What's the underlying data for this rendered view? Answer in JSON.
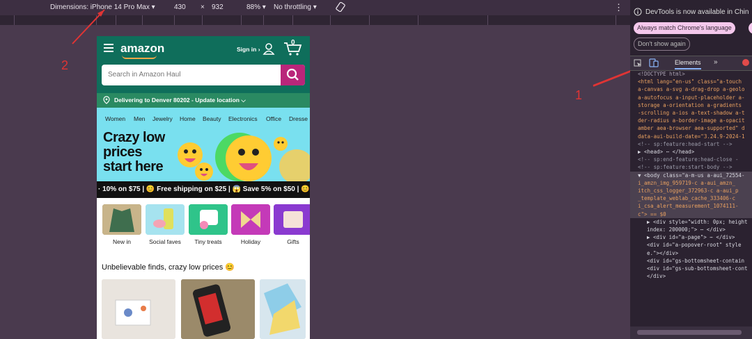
{
  "toolbar": {
    "dimensions_label": "Dimensions: iPhone 14 Pro Max",
    "width": "430",
    "times": "×",
    "height": "932",
    "zoom": "88%",
    "throttle": "No throttling"
  },
  "annotations": {
    "a1": "1",
    "a2": "2"
  },
  "phone": {
    "logo": "amazon",
    "sign_in": "Sign in ›",
    "cart_count": "0",
    "search_placeholder": "Search in Amazon Haul",
    "deliver": "Delivering to Denver 80202 - Update location ⌵",
    "categories": [
      "Women",
      "Men",
      "Jewelry",
      "Home",
      "Beauty",
      "Electronics",
      "Office",
      "Dresse"
    ],
    "hero_lines": [
      "Crazy low",
      "prices",
      "start here"
    ],
    "promo": "· 10% on $75 | 😊 Free shipping on $25 | 😱 Save 5% on $50 | 😊",
    "tiles": [
      "New in",
      "Social faves",
      "Tiny treats",
      "Holiday",
      "Gifts"
    ],
    "section_title": "Unbelievable finds, crazy low prices 😊"
  },
  "devtools": {
    "notice": "DevTools is now available in Chin",
    "match_button": "Always match Chrome's language",
    "dont_show": "Don't show again",
    "tab_elements": "Elements",
    "code_lines": [
      "<!DOCTYPE html>",
      "<html lang=\"en-us\" class=\"a-touch",
      "a-canvas a-svg a-drag-drop a-geolo",
      "a-autofocus a-input-placeholder a-",
      "storage a-orientation a-gradients",
      "-scrolling a-ios a-text-shadow a-t",
      "der-radius a-border-image a-opacit",
      "amber aea-browser aea-supported\" d",
      "data-aui-build-date=\"3.24.9-2024-1",
      "<!-- sp:feature:head-start -->",
      "▶ <head> ⋯ </head>",
      "<!-- sp:end-feature:head-close -",
      "<!-- sp:feature:start-body -->",
      "▼ <body class=\"a-m-us a-aui_72554-",
      "i_amzn_img_959719-c a-aui_amzn_",
      "itch_css_logger_372963-c a-aui_p",
      "_template_weblab_cache_333406-c",
      "i_csa_alert_measurement_1074111-",
      "c\"> == $0",
      "▶ <div style=\"width: 0px; height",
      "index: 200000;\"> ⋯ </div>",
      "▶ <div id=\"a-page\"> ⋯ </div>",
      "<div id=\"a-popover-root\" style",
      "e.\"></div>",
      "<div id=\"gs-bottomsheet-contain",
      "<div id=\"gs-sub-bottomsheet-cont",
      "</div>"
    ]
  }
}
